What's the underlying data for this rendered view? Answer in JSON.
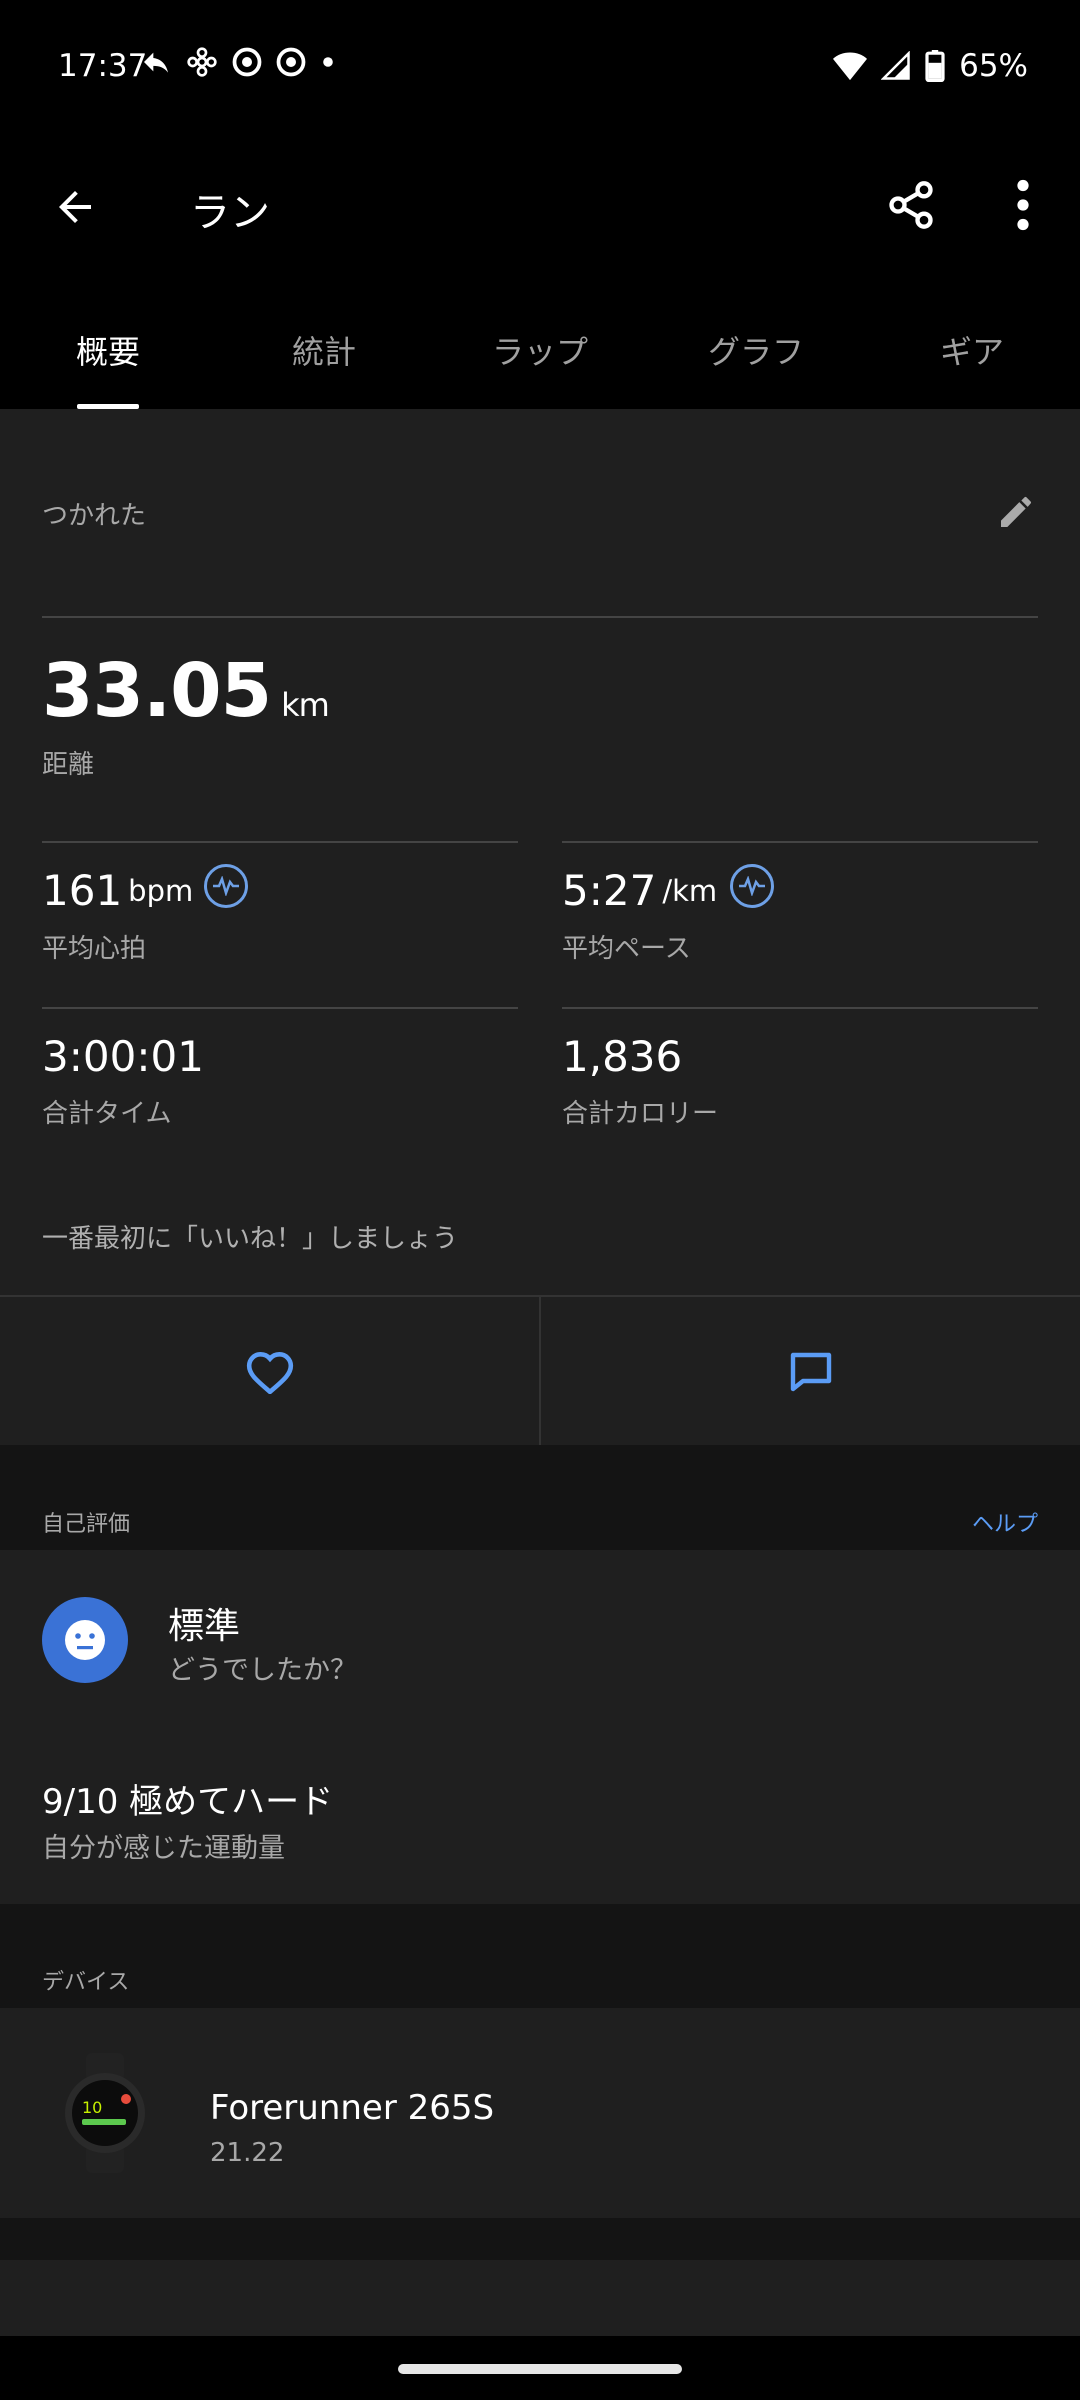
{
  "status": {
    "time": "17:37",
    "battery": "65%"
  },
  "appbar": {
    "title": "ラン"
  },
  "tabs": [
    {
      "label": "概要",
      "active": true
    },
    {
      "label": "統計",
      "active": false
    },
    {
      "label": "ラップ",
      "active": false
    },
    {
      "label": "グラフ",
      "active": false
    },
    {
      "label": "ギア",
      "active": false
    }
  ],
  "summary": {
    "title": "つかれた",
    "distance": {
      "value": "33.05",
      "unit": "km",
      "label": "距離"
    },
    "avg_hr": {
      "value": "161",
      "unit": "bpm",
      "label": "平均心拍"
    },
    "avg_pace": {
      "value": "5:27",
      "unit": "/km",
      "label": "平均ペース"
    },
    "total_time": {
      "value": "3:00:01",
      "label": "合計タイム"
    },
    "calories": {
      "value": "1,836",
      "label": "合計カロリー"
    },
    "like_prompt": "一番最初に「いいね！」しましょう"
  },
  "self_eval": {
    "section_label": "自己評価",
    "help": "ヘルプ",
    "feel_title": "標準",
    "feel_sub": "どうでしたか？",
    "effort_title": "9/10 極めてハード",
    "effort_sub": "自分が感じた運動量"
  },
  "device": {
    "section_label": "デバイス",
    "name": "Forerunner 265S",
    "version": "21.22"
  },
  "colors": {
    "accent": "#5b9cf5",
    "face": "#3a72d6",
    "card": "#1f1f1f"
  }
}
